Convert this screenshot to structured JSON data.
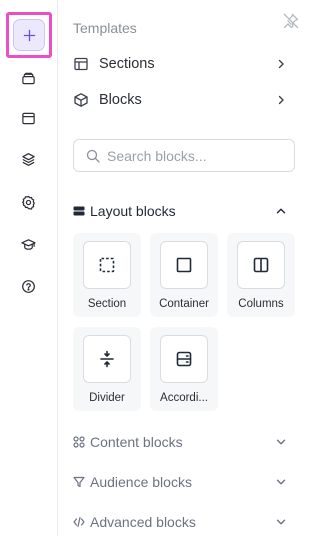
{
  "rail": {
    "items": [
      {
        "name": "add-icon"
      },
      {
        "name": "stack-icon"
      },
      {
        "name": "window-icon"
      },
      {
        "name": "layers-icon"
      },
      {
        "name": "gear-icon"
      },
      {
        "name": "graduation-cap-icon"
      },
      {
        "name": "help-icon"
      }
    ],
    "accent": "#6d4be6",
    "highlight": "#ec4ec8"
  },
  "panel": {
    "title": "Templates",
    "nav": [
      {
        "label": "Sections",
        "icon": "layout-icon"
      },
      {
        "label": "Blocks",
        "icon": "cube-icon"
      }
    ],
    "search": {
      "placeholder": "Search blocks...",
      "value": ""
    },
    "layout_group": {
      "label": "Layout blocks",
      "icon": "layout-blocks-icon",
      "expanded": true,
      "blocks": [
        {
          "label": "Section",
          "icon": "dashed-square-icon"
        },
        {
          "label": "Container",
          "icon": "square-icon"
        },
        {
          "label": "Columns",
          "icon": "columns-icon"
        },
        {
          "label": "Divider",
          "icon": "divider-icon"
        },
        {
          "label": "Accordi...",
          "icon": "accordion-icon"
        }
      ]
    },
    "collapsed_groups": [
      {
        "label": "Content blocks",
        "icon": "content-grid-icon"
      },
      {
        "label": "Audience blocks",
        "icon": "filter-icon"
      },
      {
        "label": "Advanced blocks",
        "icon": "code-icon"
      }
    ]
  }
}
